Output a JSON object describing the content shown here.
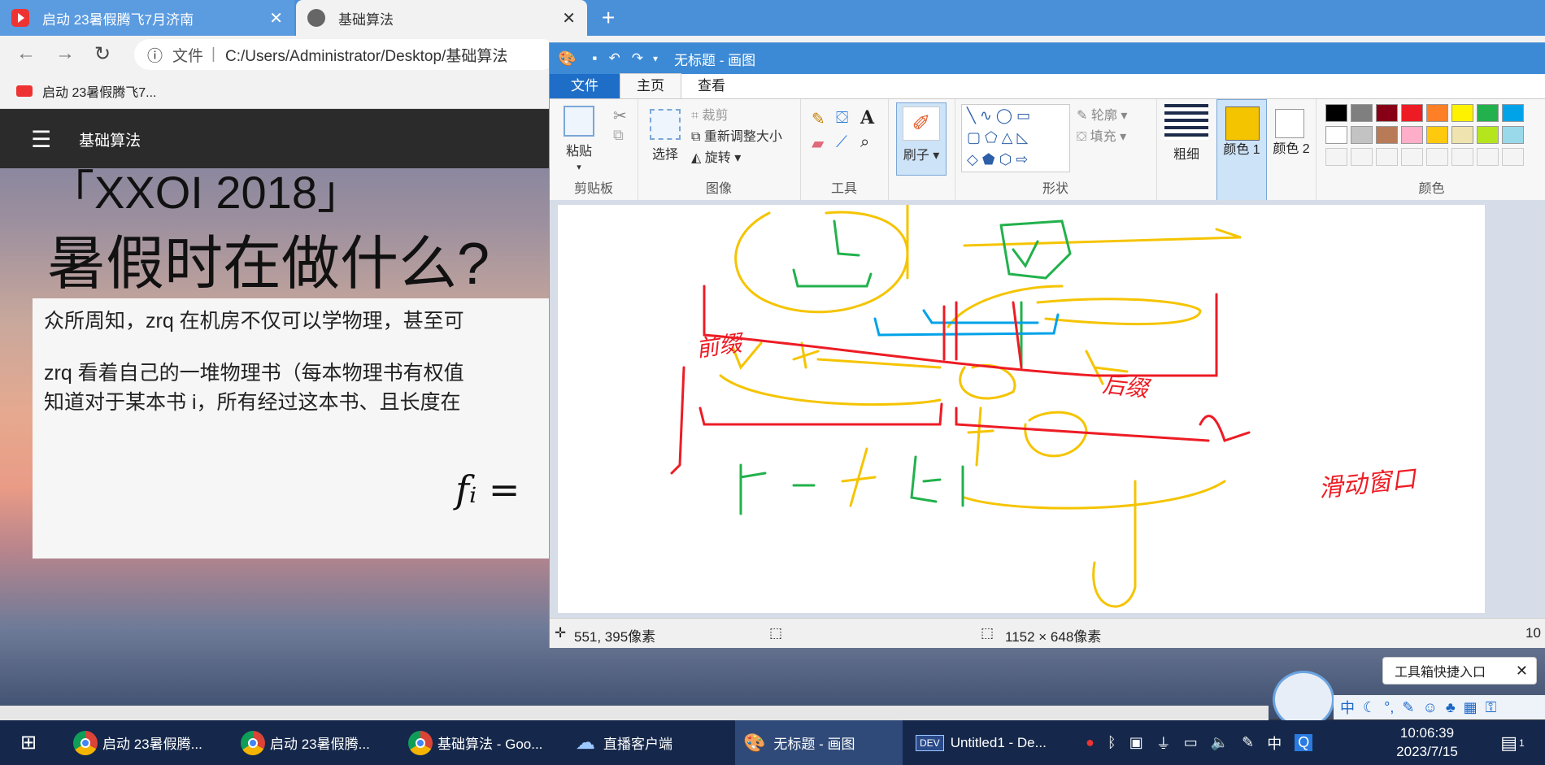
{
  "browser": {
    "tabs": [
      {
        "title": "启动 23暑假腾飞7月济南",
        "active": false
      },
      {
        "title": "基础算法",
        "active": true
      }
    ],
    "new_tab_symbol": "+",
    "url_prefix": "文件",
    "url": "C:/Users/Administrator/Desktop/基础算法",
    "bookmark": "启动 23暑假腾飞7..."
  },
  "webpage": {
    "site_name": "基础算法",
    "title_line1": "「XXOI 2018」",
    "title_line2": "暑假时在做什么?",
    "para1": "众所周知，zrq 在机房不仅可以学物理，甚至可",
    "para2_line1": "zrq 看着自己的一堆物理书（每本物理书有权值",
    "para2_line2": "知道对于某本书 i，所有经过这本书、且长度在",
    "formula": "fᵢ ="
  },
  "paint": {
    "window_title": "无标题 - 画图",
    "ribbon_tabs": [
      "文件",
      "主页",
      "查看"
    ],
    "groups": {
      "clipboard": {
        "label": "剪贴板",
        "paste": "粘贴"
      },
      "image": {
        "label": "图像",
        "select": "选择",
        "crop": "裁剪",
        "resize": "重新调整大小",
        "rotate": "旋转"
      },
      "tools": {
        "label": "工具"
      },
      "brush": {
        "label": "刷子"
      },
      "shapes": {
        "label": "形状",
        "outline": "轮廓",
        "fill": "填充"
      },
      "size": {
        "label": "粗细"
      },
      "color1": {
        "label": "颜色 1",
        "value": "#f5c400"
      },
      "color2": {
        "label": "颜色 2",
        "value": "#ffffff"
      },
      "colors": {
        "label": "颜色"
      }
    },
    "palette": [
      "#000000",
      "#7f7f7f",
      "#880015",
      "#ed1c24",
      "#ff7f27",
      "#fff200",
      "#22b14c",
      "#00a2e8",
      "#ffffff",
      "#c3c3c3",
      "#b97a57",
      "#ffaec9",
      "#ffc90e",
      "#efe4b0",
      "#b5e61d",
      "#99d9ea"
    ],
    "canvas_annotations": [
      "前缀",
      "后缀",
      "滑动窗口"
    ],
    "status": {
      "cursor_pos": "551, 395像素",
      "canvas_size": "1152 × 648像素",
      "zoom": "10"
    }
  },
  "overlay": {
    "toolbox_popup": "工具箱快捷入口",
    "ime_chars": [
      "中"
    ]
  },
  "taskbar": {
    "items": [
      {
        "label": "启动 23暑假腾...",
        "active": false
      },
      {
        "label": "启动 23暑假腾...",
        "active": false
      },
      {
        "label": "基础算法 - Goo...",
        "active": false
      },
      {
        "label": "直播客户端",
        "active": false
      },
      {
        "label": "无标题 - 画图",
        "active": true
      },
      {
        "label": "Untitled1 - De...",
        "active": false
      }
    ],
    "ime": "中",
    "time": "10:06:39",
    "date": "2023/7/15",
    "notification_count": "1"
  }
}
